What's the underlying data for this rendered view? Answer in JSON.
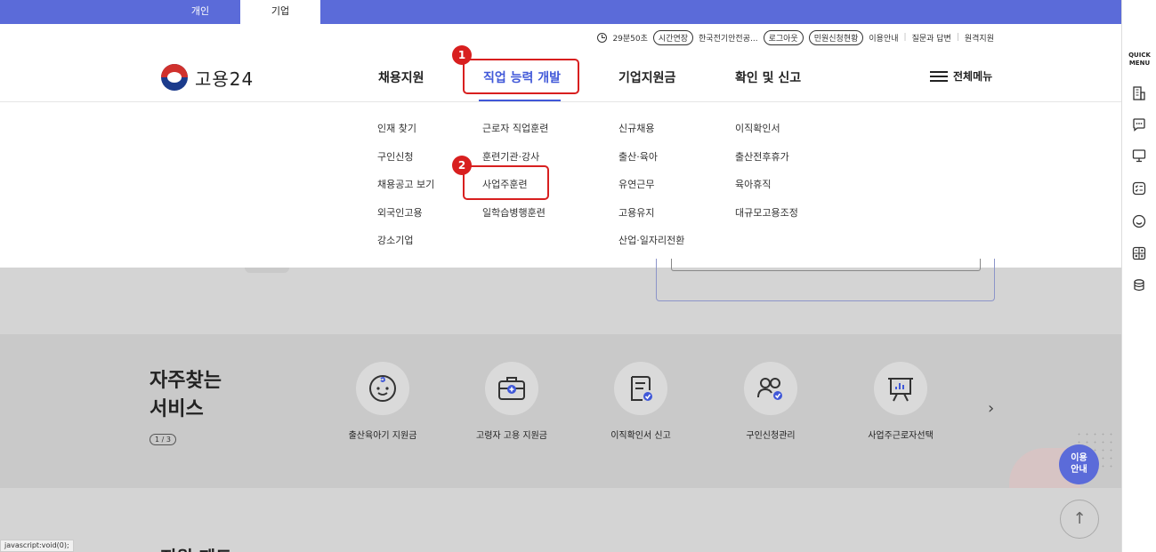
{
  "topbar": {
    "tabs": [
      "개인",
      "기업"
    ]
  },
  "utility": {
    "timer": "29분50초",
    "extend_label": "시간연장",
    "company_name": "한국전기안전공...",
    "logout_label": "로그아웃",
    "complaint_status_label": "민원신청현황",
    "links": [
      "이용안내",
      "질문과 답변",
      "원격지원"
    ]
  },
  "logo": {
    "text": "고용24"
  },
  "nav": {
    "items": [
      "채용지원",
      "직업 능력 개발",
      "기업지원금",
      "확인 및 신고"
    ],
    "all_menu": "전체메뉴"
  },
  "annotations": [
    "1",
    "2"
  ],
  "mega_menu": {
    "columns": [
      [
        "인재 찾기",
        "구인신청",
        "채용공고 보기",
        "외국인고용",
        "강소기업"
      ],
      [
        "근로자 직업훈련",
        "훈련기관·강사",
        "사업주훈련",
        "일학습병행훈련"
      ],
      [
        "신규채용",
        "출산·육아",
        "유연근무",
        "고용유지",
        "산업·일자리전환"
      ],
      [
        "이직확인서",
        "출산전후휴가",
        "육아휴직",
        "대규모고용조정"
      ]
    ]
  },
  "services": {
    "title_line1": "자주찾는",
    "title_line2": "서비스",
    "page_indicator": "1 / 3",
    "items": [
      {
        "label": "출산육아기 지원금",
        "icon": "baby-icon"
      },
      {
        "label": "고령자 고용 지원금",
        "icon": "briefcase-plus-icon"
      },
      {
        "label": "이직확인서 신고",
        "icon": "document-check-icon"
      },
      {
        "label": "구인신청관리",
        "icon": "people-check-icon"
      },
      {
        "label": "사업주근로자선택",
        "icon": "presentation-board-icon"
      }
    ],
    "next_arrow": "›"
  },
  "guide_button": {
    "line1": "이용",
    "line2": "안내"
  },
  "to_top": "↑",
  "next_section_title": "지원 제도",
  "status_bar": "javascript:void(0);",
  "quick_menu": {
    "title_line1": "QUICK",
    "title_line2": "MENU",
    "icons": [
      "building-icon",
      "chat-icon",
      "monitor-icon",
      "checklist-icon",
      "smile-icon",
      "calculator-icon",
      "database-icon"
    ]
  },
  "colors": {
    "primary": "#5b6bd9",
    "nav_active": "#4058d8",
    "highlight": "#d81f1f"
  }
}
